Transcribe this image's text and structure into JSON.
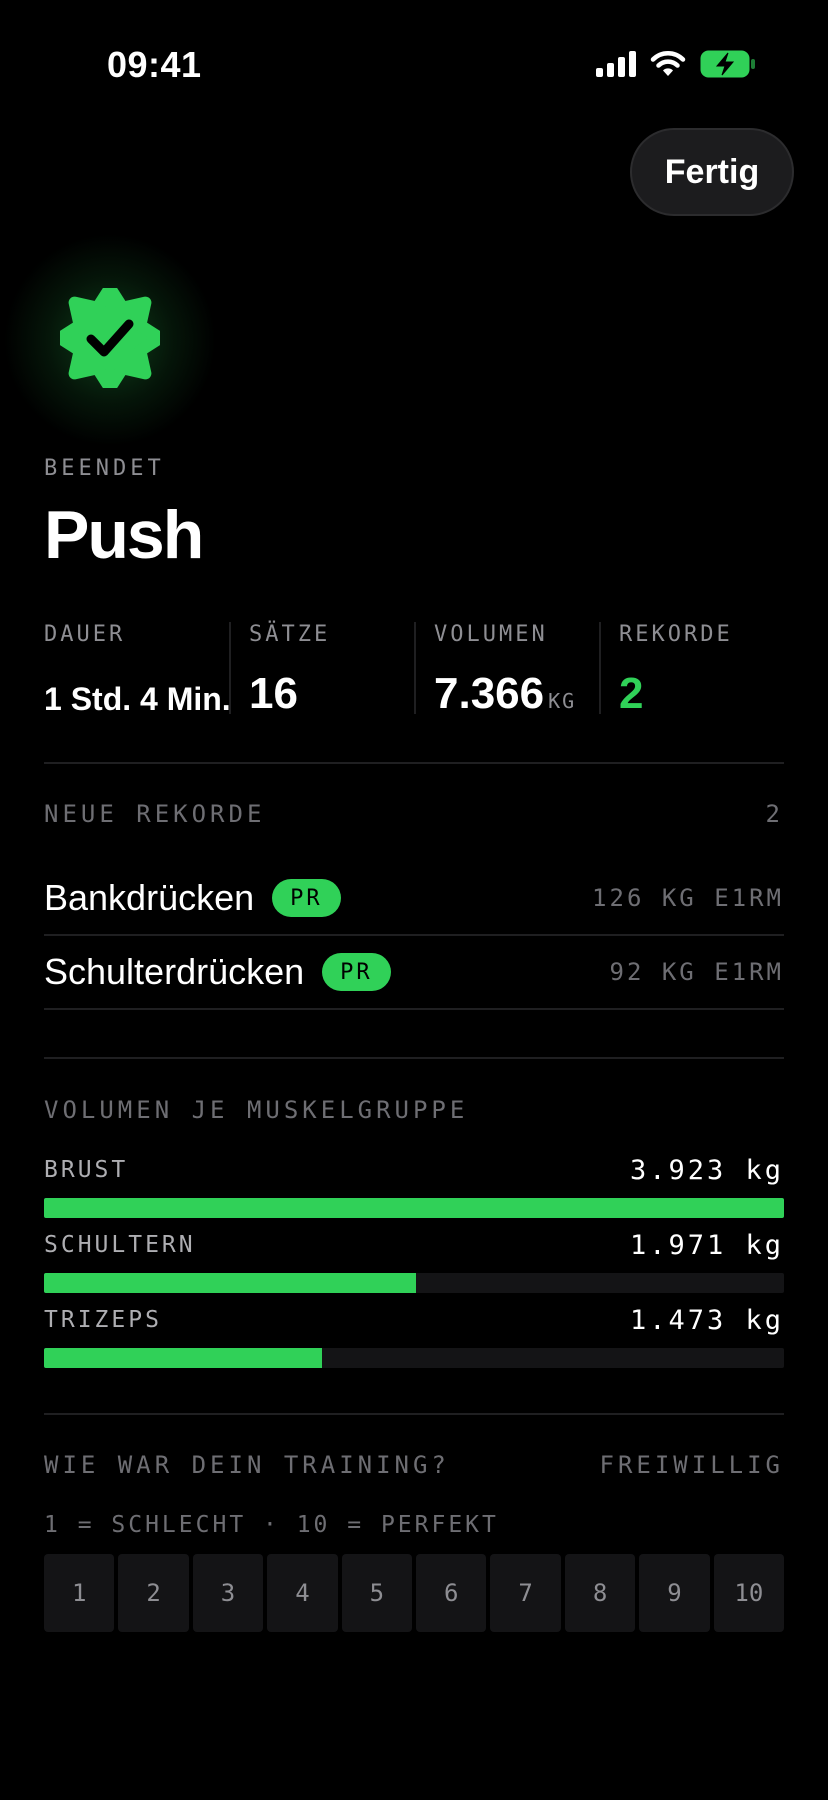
{
  "status_bar": {
    "time": "09:41"
  },
  "header": {
    "done_label": "Fertig"
  },
  "workout": {
    "eyebrow": "BEENDET",
    "title": "Push"
  },
  "stats": {
    "duration": {
      "label": "DAUER",
      "value": "1 Std. 4 Min."
    },
    "sets": {
      "label": "SÄTZE",
      "value": "16"
    },
    "volume": {
      "label": "VOLUMEN",
      "value": "7.366",
      "unit": "KG"
    },
    "records": {
      "label": "REKORDE",
      "value": "2"
    }
  },
  "new_records": {
    "title": "NEUE REKORDE",
    "count": "2",
    "items": [
      {
        "name": "Bankdrücken",
        "badge": "PR",
        "value": "126 KG E1RM"
      },
      {
        "name": "Schulterdrücken",
        "badge": "PR",
        "value": "92 KG E1RM"
      }
    ]
  },
  "muscle_volume": {
    "title": "VOLUMEN JE MUSKELGRUPPE",
    "items": [
      {
        "label": "BRUST",
        "value": "3.923 kg",
        "fraction": 1.0
      },
      {
        "label": "SCHULTERN",
        "value": "1.971 kg",
        "fraction": 0.5024
      },
      {
        "label": "TRIZEPS",
        "value": "1.473 kg",
        "fraction": 0.3755
      }
    ]
  },
  "rating": {
    "title": "WIE WAR DEIN TRAINING?",
    "optional": "FREIWILLIG",
    "hint": "1 = SCHLECHT · 10 = PERFEKT",
    "options": [
      "1",
      "2",
      "3",
      "4",
      "5",
      "6",
      "7",
      "8",
      "9",
      "10"
    ]
  },
  "colors": {
    "accent": "#30d158",
    "background": "#000000",
    "muted": "#6e6e73"
  },
  "icons": {
    "status": [
      "cellular-signal-icon",
      "wifi-icon",
      "battery-charging-icon"
    ],
    "badge": "checkmark-seal-icon"
  }
}
